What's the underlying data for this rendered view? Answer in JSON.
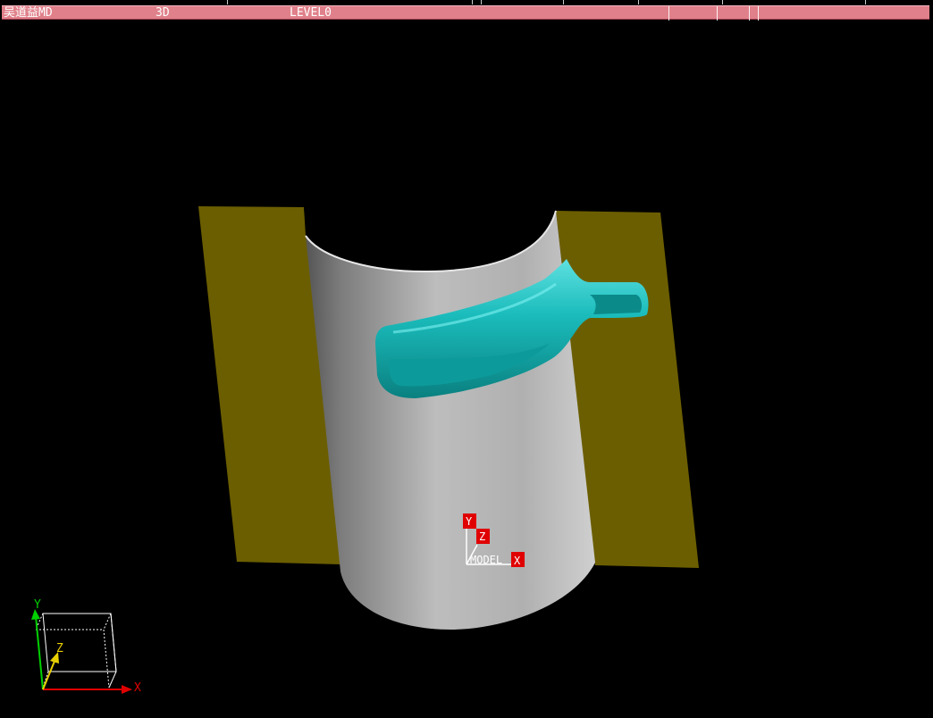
{
  "window": {
    "user_label": "吴道益MD",
    "view_mode": "3D",
    "level": "LEVEL0"
  },
  "model_axes": {
    "label": "MODEL",
    "x": "X",
    "y": "Y",
    "z": "Z"
  },
  "view_triad": {
    "x": "X",
    "y": "Y",
    "z": "Z"
  },
  "colors": {
    "titlebar": "#e0808a",
    "background": "#000000",
    "plate": "#6b5e00",
    "cylinder": "#b8b8b8",
    "slot": "#17b3b3",
    "axis_tag": "#e00000"
  }
}
